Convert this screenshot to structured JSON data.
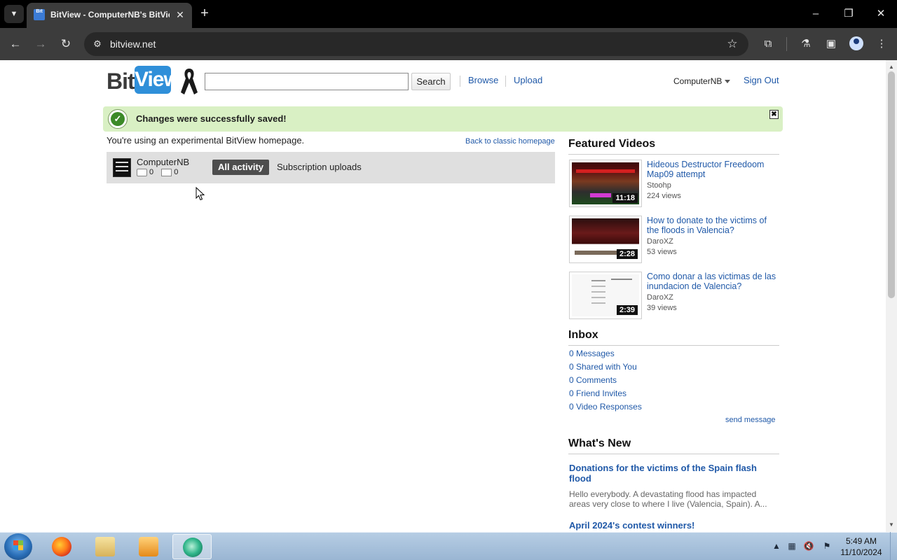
{
  "browser": {
    "tab_title": "BitView - ComputerNB's BitView",
    "tab_favicon_text": "Bit",
    "url": "bitview.net",
    "icons": {
      "tab_menu": "chevron-down-icon",
      "tab_close": "close-icon",
      "new_tab": "plus-icon",
      "back": "arrow-left-icon",
      "forward": "arrow-right-icon",
      "reload": "reload-icon",
      "site_info": "tune-icon",
      "bookmark": "star-icon",
      "extensions": "puzzle-icon",
      "labs": "flask-icon",
      "side_panel": "side-panel-icon",
      "profile": "profile-icon",
      "menu": "kebab-menu-icon"
    }
  },
  "header": {
    "logo_bit": "Bit",
    "logo_view": "View",
    "search_placeholder": "",
    "search_button": "Search",
    "nav": [
      "Browse",
      "Upload"
    ],
    "username": "ComputerNB",
    "sign_out": "Sign Out"
  },
  "banner": {
    "message": "Changes were successfully saved!",
    "close_glyph": "✖"
  },
  "main": {
    "experimental_note": "You're using an experimental BitView homepage.",
    "classic_link": "Back to classic homepage",
    "activity": {
      "username": "ComputerNB",
      "comments_count": "0",
      "messages_count": "0",
      "tabs": [
        "All activity",
        "Subscription uploads"
      ]
    }
  },
  "featured": {
    "heading": "Featured Videos",
    "videos": [
      {
        "title": "Hideous Destructor Freedoom Map09 attempt",
        "author": "Stoohp",
        "views": "224 views",
        "duration": "11:18"
      },
      {
        "title": "How to donate to the victims of the floods in Valencia?",
        "author": "DaroXZ",
        "views": "53 views",
        "duration": "2:28"
      },
      {
        "title": "Como donar a las victimas de las inundacion de Valencia?",
        "author": "DaroXZ",
        "views": "39 views",
        "duration": "2:39"
      }
    ]
  },
  "inbox": {
    "heading": "Inbox",
    "items": [
      "0 Messages",
      "0 Shared with You",
      "0 Comments",
      "0 Friend Invites",
      "0 Video Responses"
    ],
    "send_message": "send message"
  },
  "whats_new": {
    "heading": "What's New",
    "posts": [
      {
        "title": "Donations for the victims of the Spain flash flood",
        "excerpt": "Hello everybody. A devastating flood has impacted areas very close to where I live (Valencia, Spain). A..."
      },
      {
        "title": "April 2024's contest winners!"
      }
    ]
  },
  "taskbar": {
    "time": "5:49 AM",
    "date": "11/10/2024"
  },
  "colors": {
    "link": "#2059a8",
    "banner_bg": "#d9f0c4",
    "activity_bar": "#dfdfdf",
    "pill_active": "#4d4d4d",
    "logo_blue": "#2f8fd9"
  }
}
